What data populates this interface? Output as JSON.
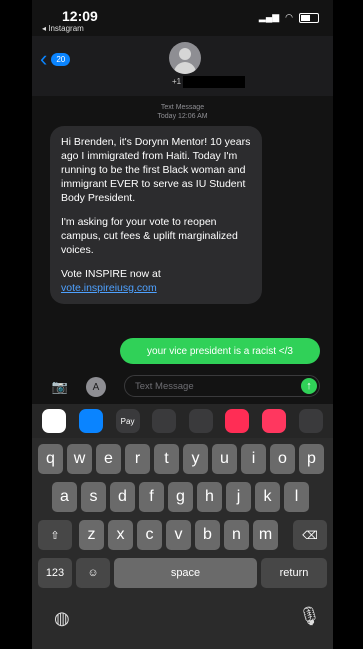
{
  "status_bar": {
    "time": "12:09",
    "back_app": "◂ Instagram"
  },
  "header": {
    "back_badge": "20",
    "contact_prefix": "+1"
  },
  "timestamp": {
    "line1": "Text Message",
    "line2": "Today 12:06 AM"
  },
  "incoming": {
    "p1": "Hi Brenden, it's Dorynn Mentor! 10 years ago I immigrated from Haiti. Today I'm running to be the first Black woman and immigrant EVER to serve as IU Student Body President.",
    "p2": "I'm asking for your vote to reopen campus, cut fees & uplift marginalized voices.",
    "p3": "Vote INSPIRE now at",
    "link": "vote.inspireiusg.com"
  },
  "outgoing": {
    "text": "your vice president is a racist </3"
  },
  "composer": {
    "placeholder": "Text Message"
  },
  "drawer": {
    "apps": [
      {
        "icon": "photos-icon",
        "color": "#ffffff"
      },
      {
        "icon": "app-store-icon",
        "color": "#0a84ff"
      },
      {
        "icon": "apple-pay-icon",
        "color": "#3a3a3c",
        "label": "Pay"
      },
      {
        "icon": "sticker-app-icon",
        "color": "#3a3a3c"
      },
      {
        "icon": "memoji-icon",
        "color": "#3a3a3c"
      },
      {
        "icon": "image-search-icon",
        "color": "#ff2d55"
      },
      {
        "icon": "music-icon",
        "color": "#ff375f"
      },
      {
        "icon": "more-stickers-icon",
        "color": "#3a3a3c"
      }
    ]
  },
  "keyboard": {
    "row1": [
      "q",
      "w",
      "e",
      "r",
      "t",
      "y",
      "u",
      "i",
      "o",
      "p"
    ],
    "row2": [
      "a",
      "s",
      "d",
      "f",
      "g",
      "h",
      "j",
      "k",
      "l"
    ],
    "row3": [
      "z",
      "x",
      "c",
      "v",
      "b",
      "n",
      "m"
    ],
    "numbers": "123",
    "space": "space",
    "return": "return"
  }
}
